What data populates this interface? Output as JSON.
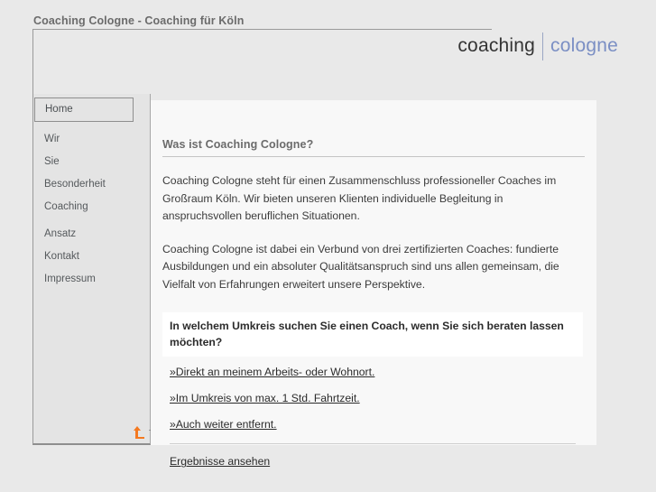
{
  "site": {
    "title": "Coaching Cologne - Coaching für Köln",
    "logo_primary": "coaching",
    "logo_secondary": "cologne",
    "accent_color": "#7b8fc4",
    "top_link_color": "#f47920"
  },
  "sidebar": {
    "items": [
      {
        "label": "Home",
        "active": true
      },
      {
        "label": "Wir",
        "active": false
      },
      {
        "label": "Sie",
        "active": false
      },
      {
        "label": "Besonderheit",
        "active": false
      },
      {
        "label": "Coaching",
        "active": false
      },
      {
        "label": "Ansatz",
        "active": false
      },
      {
        "label": "Kontakt",
        "active": false
      },
      {
        "label": "Impressum",
        "active": false
      }
    ],
    "top_link": {
      "label": "Top",
      "icon": "arrow-up-icon"
    }
  },
  "main": {
    "heading": "Was ist Coaching Cologne?",
    "paragraphs": [
      "Coaching Cologne steht für einen Zusammenschluss professioneller Coaches im Großraum Köln. Wir bieten unseren Klienten individuelle Begleitung in anspruchsvollen beruflichen Situationen.",
      "Coaching Cologne ist dabei ein Verbund von drei zertifizierten Coaches: fundierte Ausbildungen und ein absoluter Qualitätsanspruch sind uns allen gemeinsam, die Vielfalt von Erfahrungen erweitert unsere Perspektive."
    ],
    "poll": {
      "question": "In welchem Umkreis suchen Sie einen Coach, wenn Sie sich beraten lassen möchten?",
      "options": [
        "»Direkt an meinem Arbeits- oder Wohnort.",
        "»Im Umkreis von max. 1 Std. Fahrtzeit.",
        "»Auch weiter entfernt."
      ],
      "results_link": "Ergebnisse ansehen"
    }
  }
}
